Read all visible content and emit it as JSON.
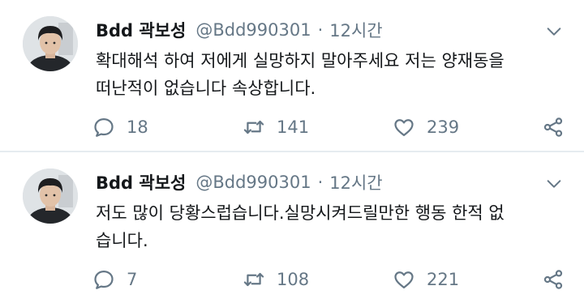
{
  "tweets": [
    {
      "name": "Bdd 곽보성",
      "handle": "@Bdd990301",
      "separator": "·",
      "time": "12시간",
      "text": "확대해석 하여 저에게 실망하지 말아주세요 저는 양재동을\n떠난적이 없습니다 속상합니다.",
      "replies": "18",
      "retweets": "141",
      "likes": "239"
    },
    {
      "name": "Bdd 곽보성",
      "handle": "@Bdd990301",
      "separator": "·",
      "time": "12시간",
      "text": "저도 많이 당황스럽습니다.실망시켜드릴만한 행동 한적 없\n습니다.",
      "replies": "7",
      "retweets": "108",
      "likes": "221"
    }
  ],
  "icons": {
    "reply": "reply-icon",
    "retweet": "retweet-icon",
    "like": "heart-icon",
    "share": "share-icon",
    "menu": "chevron-down-icon"
  },
  "colors": {
    "text": "#14171a",
    "muted": "#657786",
    "divider": "#e6ecf0"
  }
}
